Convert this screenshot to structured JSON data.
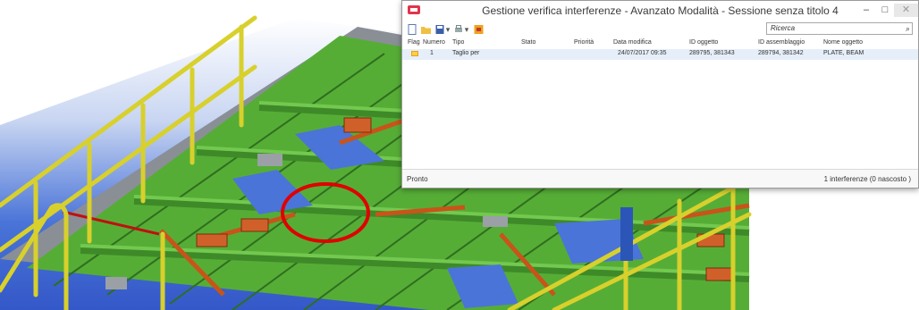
{
  "window": {
    "title": "Gestione verifica interferenze - Avanzato Modalità - Sessione senza titolo 4",
    "minimize": "–",
    "maximize": "□",
    "close": "✕"
  },
  "search": {
    "value": "Ricerca"
  },
  "columns": [
    "Flag",
    "Numero",
    "Tipo",
    "Stato",
    "Priorità",
    "Data modifica",
    "ID oggetto",
    "ID assemblaggio",
    "Nome oggetto"
  ],
  "rows": [
    {
      "flag": "",
      "numero": "1",
      "tipo": "Taglio per",
      "stato": "",
      "priorita": "",
      "data": "24/07/2017 09:35",
      "id_oggetto": "289795, 381343",
      "id_assemblaggio": "289794, 381342",
      "nome": "PLATE, BEAM"
    }
  ],
  "status": {
    "left": "Pronto",
    "right": "1 interferenze (0 nascosto )"
  },
  "colors": {
    "beam_green": "#5cb83a",
    "beam_orange": "#c8541a",
    "railing_yellow": "#d8d02c",
    "sky_blue": "#2f5fd0",
    "highlight_red": "#e00000"
  }
}
